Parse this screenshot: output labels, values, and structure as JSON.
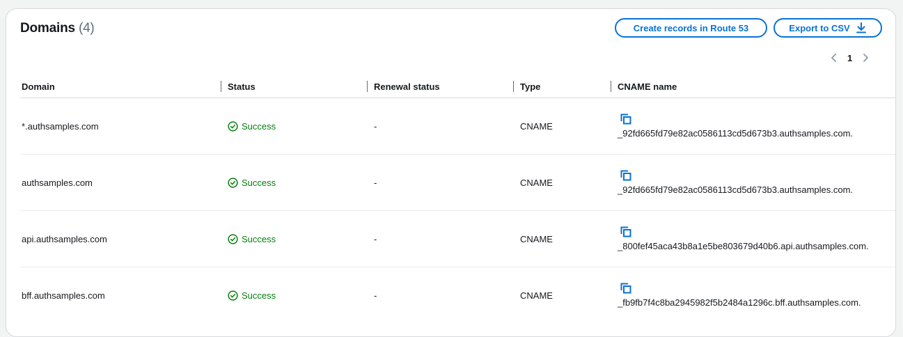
{
  "header": {
    "title": "Domains",
    "count": "(4)",
    "route53_button": "Create records in Route 53",
    "export_button": "Export to CSV",
    "page": "1"
  },
  "columns": [
    "Domain",
    "Status",
    "Renewal status",
    "Type",
    "CNAME name"
  ],
  "rows": [
    {
      "domain": "*.authsamples.com",
      "status": "Success",
      "renewal": "-",
      "type": "CNAME",
      "cname": "_92fd665fd79e82ac0586113cd5d673b3.authsamples.com."
    },
    {
      "domain": "authsamples.com",
      "status": "Success",
      "renewal": "-",
      "type": "CNAME",
      "cname": "_92fd665fd79e82ac0586113cd5d673b3.authsamples.com."
    },
    {
      "domain": "api.authsamples.com",
      "status": "Success",
      "renewal": "-",
      "type": "CNAME",
      "cname": "_800fef45aca43b8a1e5be803679d40b6.api.authsamples.com."
    },
    {
      "domain": "bff.authsamples.com",
      "status": "Success",
      "renewal": "-",
      "type": "CNAME",
      "cname": "_fb9fb7f4c8ba2945982f5b2484a1296c.bff.authsamples.com."
    }
  ],
  "colors": {
    "accent": "#0972d3",
    "success": "#037f0c"
  }
}
